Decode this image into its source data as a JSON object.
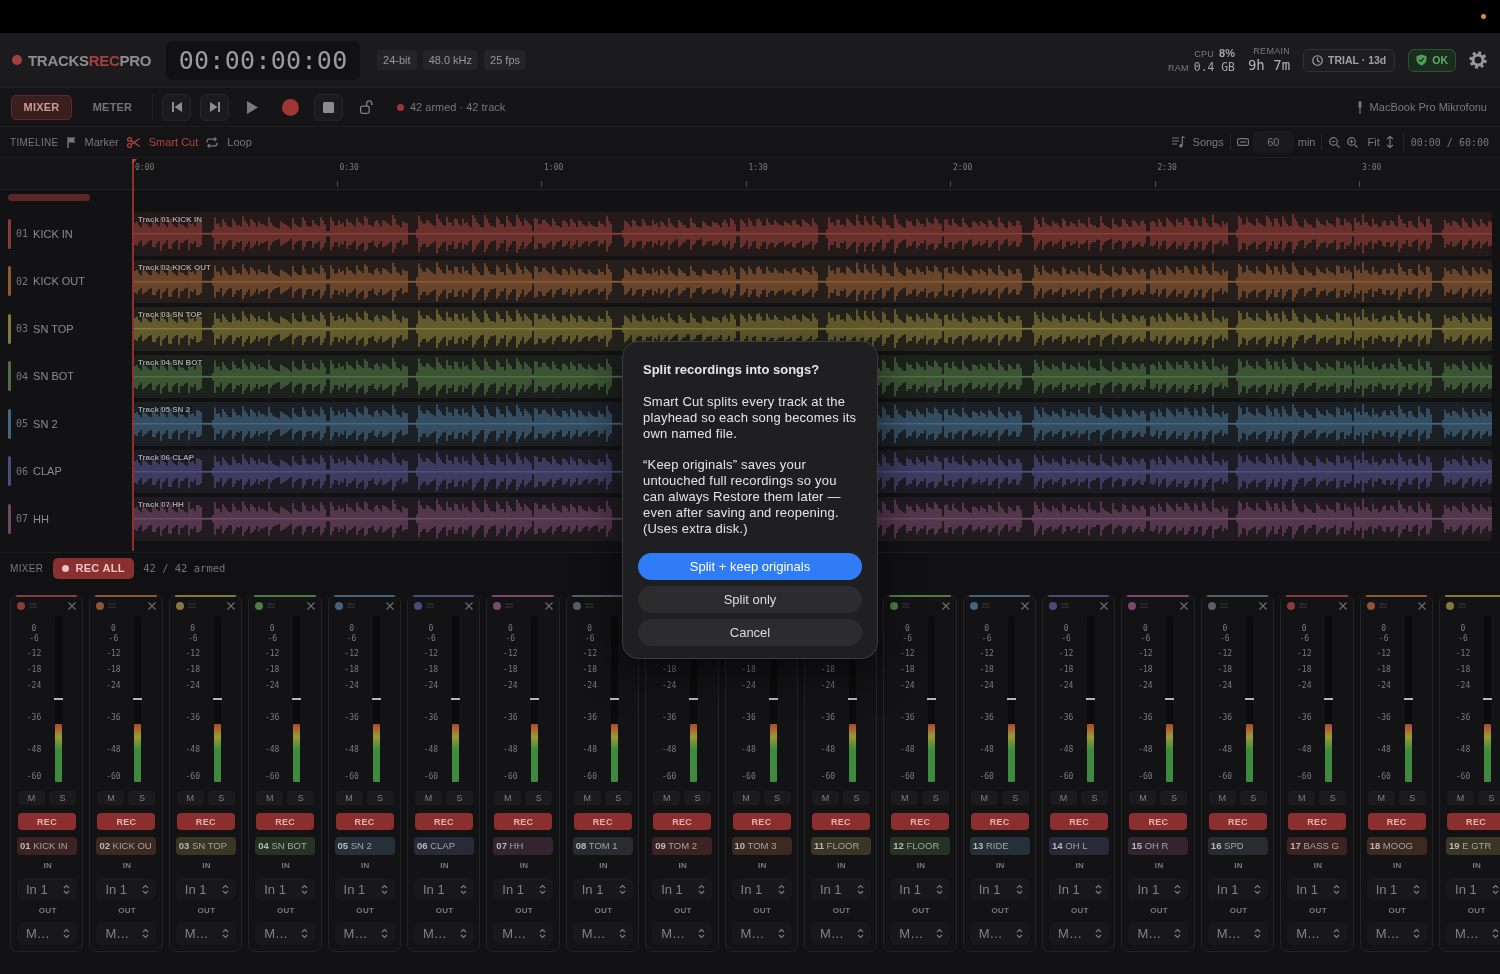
{
  "app": {
    "logo": {
      "prefix": "TRACKS",
      "accent": "REC",
      "suffix": "PRO"
    },
    "timecode": "00:00:00:00",
    "format_tags": [
      "24-bit",
      "48.0 kHz",
      "25 fps"
    ]
  },
  "stats": {
    "cpu_label": "CPU",
    "cpu_value": "8%",
    "ram_label": "RAM",
    "ram_value": "0.4 GB",
    "remain_label": "REMAIN",
    "remain_value": "9h 7m"
  },
  "status": {
    "trial": "TRIAL · 13d",
    "health": "OK"
  },
  "view_tabs": [
    {
      "label": "MIXER",
      "selected": true
    },
    {
      "label": "METER",
      "selected": false
    }
  ],
  "transport": {
    "armed_status": "42 armed · 42 track",
    "input_device": "MacBook Pro Mikrofonu"
  },
  "timeline_bar": {
    "title": "TIMELINE",
    "tools": [
      {
        "kind": "marker",
        "label": "Marker",
        "active": false
      },
      {
        "kind": "cut",
        "label": "Smart Cut",
        "active": true
      },
      {
        "kind": "loop",
        "label": "Loop",
        "active": false
      }
    ],
    "songs": "Songs",
    "length": {
      "value": "60",
      "unit": "min"
    },
    "fit": "Fit",
    "position": "00:00 / 60:00"
  },
  "timeline": {
    "ruler_labels": [
      "0:00",
      "0:30",
      "1:00",
      "1:30",
      "2:00",
      "2:30",
      "3:00"
    ],
    "tracks": [
      {
        "number": "01",
        "name": "KICK IN",
        "clip_label": "Track 01 KICK IN",
        "color": "#8c3d36"
      },
      {
        "number": "02",
        "name": "KICK OUT",
        "clip_label": "Track 02 KICK OUT",
        "color": "#8c5a34"
      },
      {
        "number": "03",
        "name": "SN TOP",
        "clip_label": "Track 03 SN TOP",
        "color": "#857a38"
      },
      {
        "number": "04",
        "name": "SN BOT",
        "clip_label": "Track 04 SN BOT",
        "color": "#4f7043"
      },
      {
        "number": "05",
        "name": "SN 2",
        "clip_label": "Track 05 SN 2",
        "color": "#436782"
      },
      {
        "number": "06",
        "name": "CLAP",
        "clip_label": "Track 06 CLAP",
        "color": "#514d80"
      },
      {
        "number": "07",
        "name": "HH",
        "clip_label": "Track 07 HH",
        "color": "#704766"
      }
    ]
  },
  "mixer": {
    "title": "MIXER",
    "rec_all": "REC ALL",
    "armed_count": "42 / 42 armed",
    "strips": [
      {
        "number": "01",
        "name": "KICK IN",
        "color": "#3c2322",
        "level": 0.35,
        "fader": {
          "level": 0.5
        },
        "scale": [
          "0",
          "-6",
          "-12",
          "-18",
          "-24",
          "-36",
          "-48",
          "-60"
        ],
        "mute": "M",
        "muted": false,
        "solo": "S",
        "soloed": false,
        "rec": "REC",
        "armed": true,
        "in_label": "IN",
        "input": "In 1",
        "out_label": "OUT",
        "output": "M…"
      },
      {
        "number": "02",
        "name": "KICK OU",
        "color": "#3c2a20",
        "level": 0.35,
        "fader": {
          "level": 0.5
        },
        "scale": [
          "0",
          "-6",
          "-12",
          "-18",
          "-24",
          "-36",
          "-48",
          "-60"
        ],
        "mute": "M",
        "muted": false,
        "solo": "S",
        "soloed": false,
        "rec": "REC",
        "armed": true,
        "in_label": "IN",
        "input": "In 1",
        "out_label": "OUT",
        "output": "M…"
      },
      {
        "number": "03",
        "name": "SN TOP",
        "color": "#3a3623",
        "level": 0.35,
        "fader": {
          "level": 0.5
        },
        "scale": [
          "0",
          "-6",
          "-12",
          "-18",
          "-24",
          "-36",
          "-48",
          "-60"
        ],
        "mute": "M",
        "muted": false,
        "solo": "S",
        "soloed": false,
        "rec": "REC",
        "armed": true,
        "in_label": "IN",
        "input": "In 1",
        "out_label": "OUT",
        "output": "M…"
      },
      {
        "number": "04",
        "name": "SN BOT",
        "color": "#263323",
        "level": 0.35,
        "fader": {
          "level": 0.5
        },
        "scale": [
          "0",
          "-6",
          "-12",
          "-18",
          "-24",
          "-36",
          "-48",
          "-60"
        ],
        "mute": "M",
        "muted": false,
        "solo": "S",
        "soloed": false,
        "rec": "REC",
        "armed": true,
        "in_label": "IN",
        "input": "In 1",
        "out_label": "OUT",
        "output": "M…"
      },
      {
        "number": "05",
        "name": "SN 2",
        "color": "#263039",
        "level": 0.35,
        "fader": {
          "level": 0.5
        },
        "scale": [
          "0",
          "-6",
          "-12",
          "-18",
          "-24",
          "-36",
          "-48",
          "-60"
        ],
        "mute": "M",
        "muted": false,
        "solo": "S",
        "soloed": false,
        "rec": "REC",
        "armed": true,
        "in_label": "IN",
        "input": "In 1",
        "out_label": "OUT",
        "output": "M…"
      },
      {
        "number": "06",
        "name": "CLAP",
        "color": "#2a2939",
        "level": 0.35,
        "fader": {
          "level": 0.5
        },
        "scale": [
          "0",
          "-6",
          "-12",
          "-18",
          "-24",
          "-36",
          "-48",
          "-60"
        ],
        "mute": "M",
        "muted": false,
        "solo": "S",
        "soloed": false,
        "rec": "REC",
        "armed": true,
        "in_label": "IN",
        "input": "In 1",
        "out_label": "OUT",
        "output": "M…"
      },
      {
        "number": "07",
        "name": "HH",
        "color": "#33242f",
        "level": 0.35,
        "fader": {
          "level": 0.5
        },
        "scale": [
          "0",
          "-6",
          "-12",
          "-18",
          "-24",
          "-36",
          "-48",
          "-60"
        ],
        "mute": "M",
        "muted": false,
        "solo": "S",
        "soloed": false,
        "rec": "REC",
        "armed": true,
        "in_label": "IN",
        "input": "In 1",
        "out_label": "OUT",
        "output": "M…"
      },
      {
        "number": "08",
        "name": "TOM 1",
        "color": "#2a2b2f",
        "level": 0.35,
        "fader": {
          "level": 0.5
        },
        "scale": [
          "0",
          "-6",
          "-12",
          "-18",
          "-24",
          "-36",
          "-48",
          "-60"
        ],
        "mute": "M",
        "muted": false,
        "solo": "S",
        "soloed": false,
        "rec": "REC",
        "armed": true,
        "in_label": "IN",
        "input": "In 1",
        "out_label": "OUT",
        "output": "M…"
      },
      {
        "number": "09",
        "name": "TOM 2",
        "color": "#3c2322",
        "level": 0.35,
        "fader": {
          "level": 0.5
        },
        "scale": [
          "-18",
          "-24",
          "-36",
          "-48",
          "-60"
        ],
        "mute": "M",
        "muted": false,
        "solo": "S",
        "soloed": false,
        "rec": "REC",
        "armed": true,
        "in_label": "IN",
        "input": "In 1",
        "out_label": "OUT",
        "output": "M…"
      },
      {
        "number": "10",
        "name": "TOM 3",
        "color": "#3c2a20",
        "level": 0.35,
        "fader": {
          "level": 0.5
        },
        "scale": [
          "-18",
          "-24",
          "-36",
          "-48",
          "-60"
        ],
        "mute": "M",
        "muted": false,
        "solo": "S",
        "soloed": false,
        "rec": "REC",
        "armed": true,
        "in_label": "IN",
        "input": "In 1",
        "out_label": "OUT",
        "output": "M…"
      },
      {
        "number": "11",
        "name": "FLOOR",
        "color": "#3a3623",
        "level": 0.35,
        "fader": {
          "level": 0.5
        },
        "scale": [
          "-18",
          "-24",
          "-36",
          "-48",
          "-60"
        ],
        "mute": "M",
        "muted": false,
        "solo": "S",
        "soloed": false,
        "rec": "REC",
        "armed": true,
        "in_label": "IN",
        "input": "In 1",
        "out_label": "OUT",
        "output": "M…"
      },
      {
        "number": "12",
        "name": "FLOOR",
        "color": "#263323",
        "level": 0.35,
        "fader": {
          "level": 0.5
        },
        "scale": [
          "0",
          "-6",
          "-12",
          "-18",
          "-24",
          "-36",
          "-48",
          "-60"
        ],
        "mute": "M",
        "muted": false,
        "solo": "S",
        "soloed": false,
        "rec": "REC",
        "armed": true,
        "in_label": "IN",
        "input": "In 1",
        "out_label": "OUT",
        "output": "M…"
      },
      {
        "number": "13",
        "name": "RIDE",
        "color": "#263039",
        "level": 0.35,
        "fader": {
          "level": 0.5
        },
        "scale": [
          "0",
          "-6",
          "-12",
          "-18",
          "-24",
          "-36",
          "-48",
          "-60"
        ],
        "mute": "M",
        "muted": false,
        "solo": "S",
        "soloed": false,
        "rec": "REC",
        "armed": true,
        "in_label": "IN",
        "input": "In 1",
        "out_label": "OUT",
        "output": "M…"
      },
      {
        "number": "14",
        "name": "OH L",
        "color": "#2a2939",
        "level": 0.35,
        "fader": {
          "level": 0.5
        },
        "scale": [
          "0",
          "-6",
          "-12",
          "-18",
          "-24",
          "-36",
          "-48",
          "-60"
        ],
        "mute": "M",
        "muted": false,
        "solo": "S",
        "soloed": false,
        "rec": "REC",
        "armed": true,
        "in_label": "IN",
        "input": "In 1",
        "out_label": "OUT",
        "output": "M…"
      },
      {
        "number": "15",
        "name": "OH R",
        "color": "#33242f",
        "level": 0.35,
        "fader": {
          "level": 0.5
        },
        "scale": [
          "0",
          "-6",
          "-12",
          "-18",
          "-24",
          "-36",
          "-48",
          "-60"
        ],
        "mute": "M",
        "muted": false,
        "solo": "S",
        "soloed": false,
        "rec": "REC",
        "armed": true,
        "in_label": "IN",
        "input": "In 1",
        "out_label": "OUT",
        "output": "M…"
      },
      {
        "number": "16",
        "name": "SPD",
        "color": "#2a2b2f",
        "level": 0.35,
        "fader": {
          "level": 0.5
        },
        "scale": [
          "0",
          "-6",
          "-12",
          "-18",
          "-24",
          "-36",
          "-48",
          "-60"
        ],
        "mute": "M",
        "muted": false,
        "solo": "S",
        "soloed": false,
        "rec": "REC",
        "armed": true,
        "in_label": "IN",
        "input": "In 1",
        "out_label": "OUT",
        "output": "M…"
      },
      {
        "number": "17",
        "name": "BASS G",
        "color": "#3c2322",
        "level": 0.35,
        "fader": {
          "level": 0.5
        },
        "scale": [
          "0",
          "-6",
          "-12",
          "-18",
          "-24",
          "-36",
          "-48",
          "-60"
        ],
        "mute": "M",
        "muted": false,
        "solo": "S",
        "soloed": false,
        "rec": "REC",
        "armed": true,
        "in_label": "IN",
        "input": "In 1",
        "out_label": "OUT",
        "output": "M…"
      },
      {
        "number": "18",
        "name": "MOOG",
        "color": "#3c2a20",
        "level": 0.35,
        "fader": {
          "level": 0.5
        },
        "scale": [
          "0",
          "-6",
          "-12",
          "-18",
          "-24",
          "-36",
          "-48",
          "-60"
        ],
        "mute": "M",
        "muted": false,
        "solo": "S",
        "soloed": false,
        "rec": "REC",
        "armed": true,
        "in_label": "IN",
        "input": "In 1",
        "out_label": "OUT",
        "output": "M…"
      },
      {
        "number": "19",
        "name": "E GTR",
        "color": "#3a3623",
        "level": 0.35,
        "fader": {
          "level": 0.5
        },
        "scale": [
          "0",
          "-6",
          "-12",
          "-18",
          "-24",
          "-36",
          "-48",
          "-60"
        ],
        "mute": "M",
        "muted": false,
        "solo": "S",
        "soloed": false,
        "rec": "REC",
        "armed": true,
        "in_label": "IN",
        "input": "In 1",
        "out_label": "OUT",
        "output": "M…"
      }
    ]
  },
  "dialog": {
    "title": "Split recordings into songs?",
    "paragraphs": [
      "Smart Cut splits every track at the playhead so each song becomes its own named file.",
      "“Keep originals” saves your untouched full recordings so you can always Restore them later — even after saving and reopening. (Uses extra disk.)"
    ],
    "buttons": [
      {
        "label": "Split + keep originals",
        "kind": "primary"
      },
      {
        "label": "Split only",
        "kind": "secondary"
      },
      {
        "label": "Cancel",
        "kind": "secondary"
      }
    ]
  }
}
